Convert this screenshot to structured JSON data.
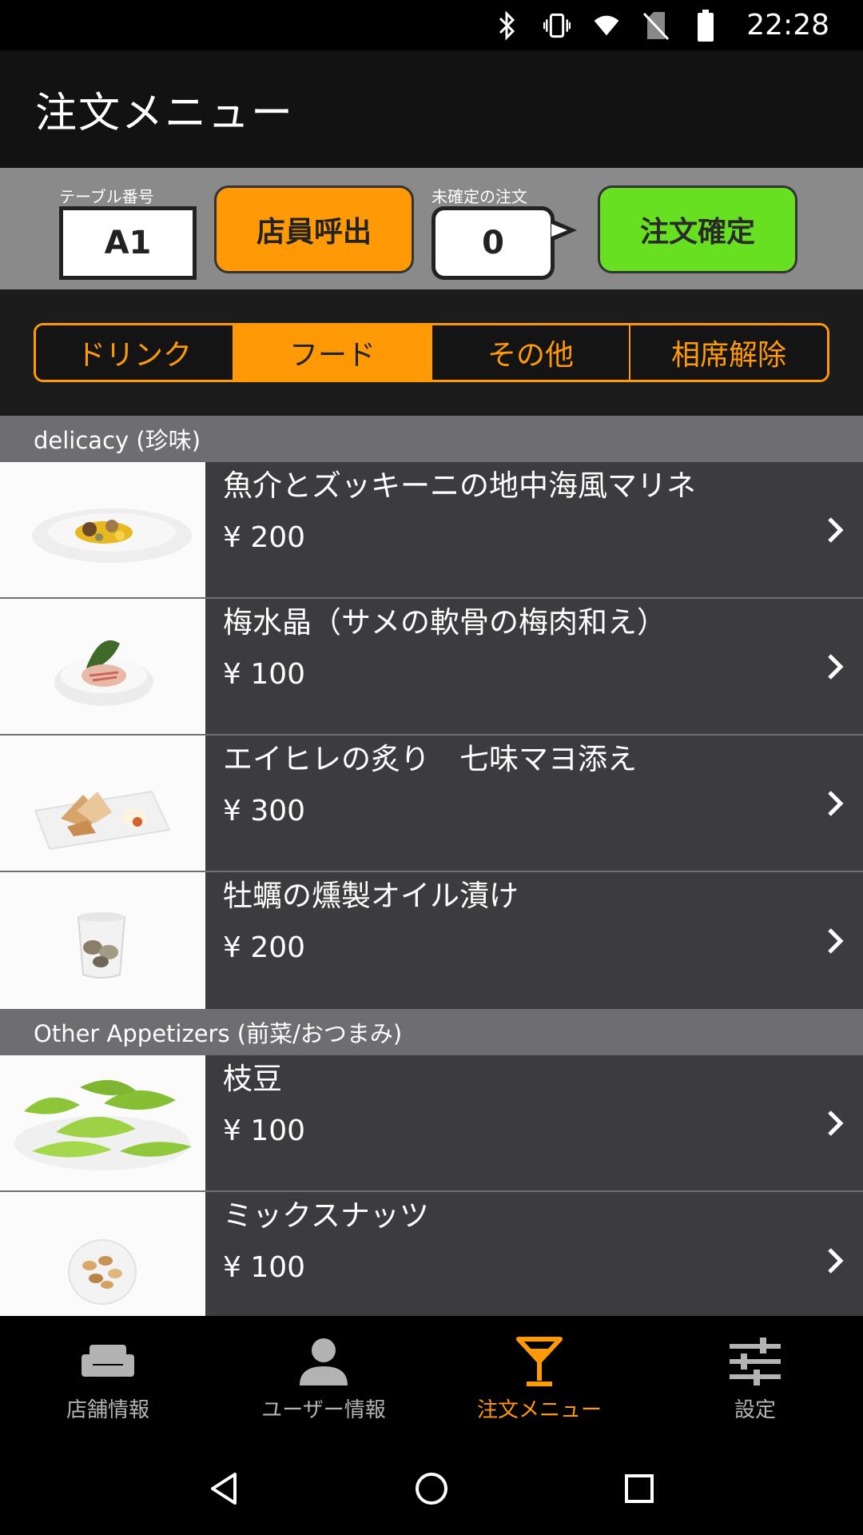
{
  "status_bar": {
    "time": "22:28",
    "icons": [
      "bluetooth-icon",
      "vibrate-icon",
      "wifi-icon",
      "no-sim-icon",
      "battery-icon"
    ]
  },
  "app_bar": {
    "title": "注文メニュー"
  },
  "controls": {
    "table_number_label": "テーブル番号",
    "table_number": "A1",
    "call_staff_label": "店員呼出",
    "pending_label": "未確定の注文",
    "pending_count": "0",
    "confirm_label": "注文確定"
  },
  "tabs": [
    {
      "label": "ドリンク",
      "active": false
    },
    {
      "label": "フード",
      "active": true
    },
    {
      "label": "その他",
      "active": false
    },
    {
      "label": "相席解除",
      "active": false
    }
  ],
  "sections": [
    {
      "title": "delicacy (珍味)",
      "items": [
        {
          "name": "魚介とズッキーニの地中海風マリネ",
          "price": "¥ 200"
        },
        {
          "name": "梅水晶（サメの軟骨の梅肉和え）",
          "price": "¥ 100"
        },
        {
          "name": "エイヒレの炙り　七味マヨ添え",
          "price": "¥ 300"
        },
        {
          "name": "牡蠣の燻製オイル漬け",
          "price": "¥ 200"
        }
      ]
    },
    {
      "title": "Other Appetizers (前菜/おつまみ)",
      "items": [
        {
          "name": "枝豆",
          "price": "¥ 100"
        },
        {
          "name": "ミックスナッツ",
          "price": "¥ 100"
        }
      ]
    }
  ],
  "bottom_nav": [
    {
      "label": "店舗情報",
      "icon": "sofa-icon",
      "active": false
    },
    {
      "label": "ユーザー情報",
      "icon": "person-icon",
      "active": false
    },
    {
      "label": "注文メニュー",
      "icon": "cocktail-icon",
      "active": true
    },
    {
      "label": "設定",
      "icon": "sliders-icon",
      "active": false
    }
  ],
  "colors": {
    "accent": "#ff9a06",
    "confirm": "#66e020",
    "list_bg": "#3c3c3e",
    "section_bg": "#6e6e72"
  }
}
